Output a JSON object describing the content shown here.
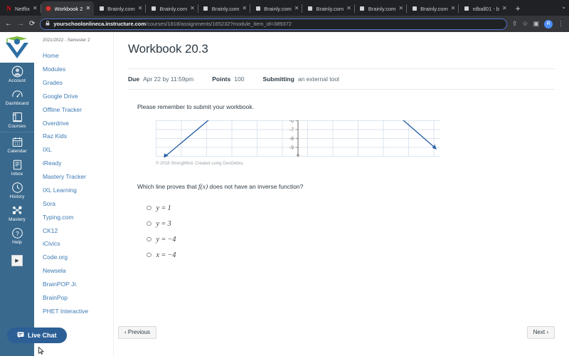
{
  "browser": {
    "tabs": [
      {
        "title": "Netflix",
        "favicon": "netflix-icon",
        "active": false
      },
      {
        "title": "Workbook 2",
        "favicon": "canvas-icon",
        "active": true
      },
      {
        "title": "Brainly.com",
        "favicon": "brainly-icon",
        "active": false
      },
      {
        "title": "Brainly.com",
        "favicon": "brainly-icon",
        "active": false
      },
      {
        "title": "Brainly.com",
        "favicon": "brainly-icon",
        "active": false
      },
      {
        "title": "Brainly.com",
        "favicon": "brainly-icon",
        "active": false
      },
      {
        "title": "Brainly.com",
        "favicon": "brainly-icon",
        "active": false
      },
      {
        "title": "Brainly.com",
        "favicon": "brainly-icon",
        "active": false
      },
      {
        "title": "Brainly.com",
        "favicon": "brainly-icon",
        "active": false
      },
      {
        "title": "rdball01 - b",
        "favicon": "brainly-icon",
        "active": false
      }
    ],
    "new_tab_label": "+",
    "tab_list_label": "⌄",
    "back_label": "←",
    "forward_label": "→",
    "reload_label": "⟳",
    "lock_label": "🔒",
    "url_host": "yourschoolonlineca.instructure.com",
    "url_path": "/courses/1818/assignments/165232?module_item_id=389372",
    "share_label": "⇧",
    "bookmark_label": "☆",
    "sidepanel_label": "▣",
    "profile_initial": "R",
    "menu_label": "⋮"
  },
  "global_nav": {
    "logo_name": "school-logo",
    "items": [
      {
        "label": "Account",
        "icon": "account-icon"
      },
      {
        "label": "Dashboard",
        "icon": "dashboard-icon"
      },
      {
        "label": "Courses",
        "icon": "courses-icon"
      },
      {
        "label": "Calendar",
        "icon": "calendar-icon"
      },
      {
        "label": "Inbox",
        "icon": "inbox-icon"
      },
      {
        "label": "History",
        "icon": "history-icon"
      },
      {
        "label": "Mastery",
        "icon": "mastery-icon"
      },
      {
        "label": "Help",
        "icon": "help-icon"
      }
    ],
    "toggle_label": "▶"
  },
  "course_nav": {
    "term": "2021/2022 - Semester 2",
    "links": [
      "Home",
      "Modules",
      "Grades",
      "Google Drive",
      "Offline Tracker",
      "Overdrive",
      "Raz Kids",
      "IXL",
      "iReady",
      "Mastery Tracker",
      "IXL Learning",
      "Sora",
      "Typing.com",
      "CK12",
      "iCivics",
      "Code.org",
      "Newsela",
      "BrainPOP Jr.",
      "BrainPop",
      "PHET Interactive"
    ]
  },
  "assignment": {
    "title": "Workbook 20.3",
    "meta": [
      {
        "key": "Due",
        "value": "Apr 22 by 11:59pm"
      },
      {
        "key": "Points",
        "value": "100"
      },
      {
        "key": "Submitting",
        "value": "an external tool"
      }
    ],
    "intro": "Please remember to submit your workbook.",
    "graph_credit": "© 2018 StrongMind. Created using GeoGebra.",
    "question": {
      "prefix": "Which line proves that ",
      "fx": "f(x)",
      "suffix": " does not have an inverse function?",
      "choices": [
        "y = 1",
        "y = 3",
        "y = −4",
        "x = −4"
      ]
    },
    "previous_label": "‹ Previous",
    "next_label": "Next ›"
  },
  "chart_data": {
    "type": "line",
    "title": "",
    "xlabel": "",
    "ylabel": "",
    "yticks": [
      "-6",
      "-7",
      "-8",
      "-9"
    ],
    "ytick_values": [
      -6,
      -7,
      -8,
      -9
    ],
    "grid": true,
    "legend": null,
    "axis_color": "#8a8a8a",
    "grid_color": "#cfdcea",
    "curve_color": "#2e62a6",
    "series": [
      {
        "name": "left-branch",
        "comment": "rising segment with arrowhead at lower-left",
        "points": [
          [
            -9.2,
            -9.6
          ],
          [
            -6.0,
            -5.7
          ]
        ]
      },
      {
        "name": "right-branch",
        "comment": "falling segment with arrowhead at lower-right",
        "points": [
          [
            7.4,
            -5.7
          ],
          [
            9.6,
            -8.6
          ]
        ]
      }
    ]
  },
  "live_chat": {
    "label": "Live Chat",
    "icon": "chat-bubble-icon"
  },
  "colors": {
    "global_nav_bg": "#39698d",
    "link_blue": "#3c7ab3",
    "chat_blue": "#2b5f96",
    "curve_blue": "#2e62a6",
    "grid_blue": "#cfdcea",
    "heading_dark": "#2d3b45"
  }
}
